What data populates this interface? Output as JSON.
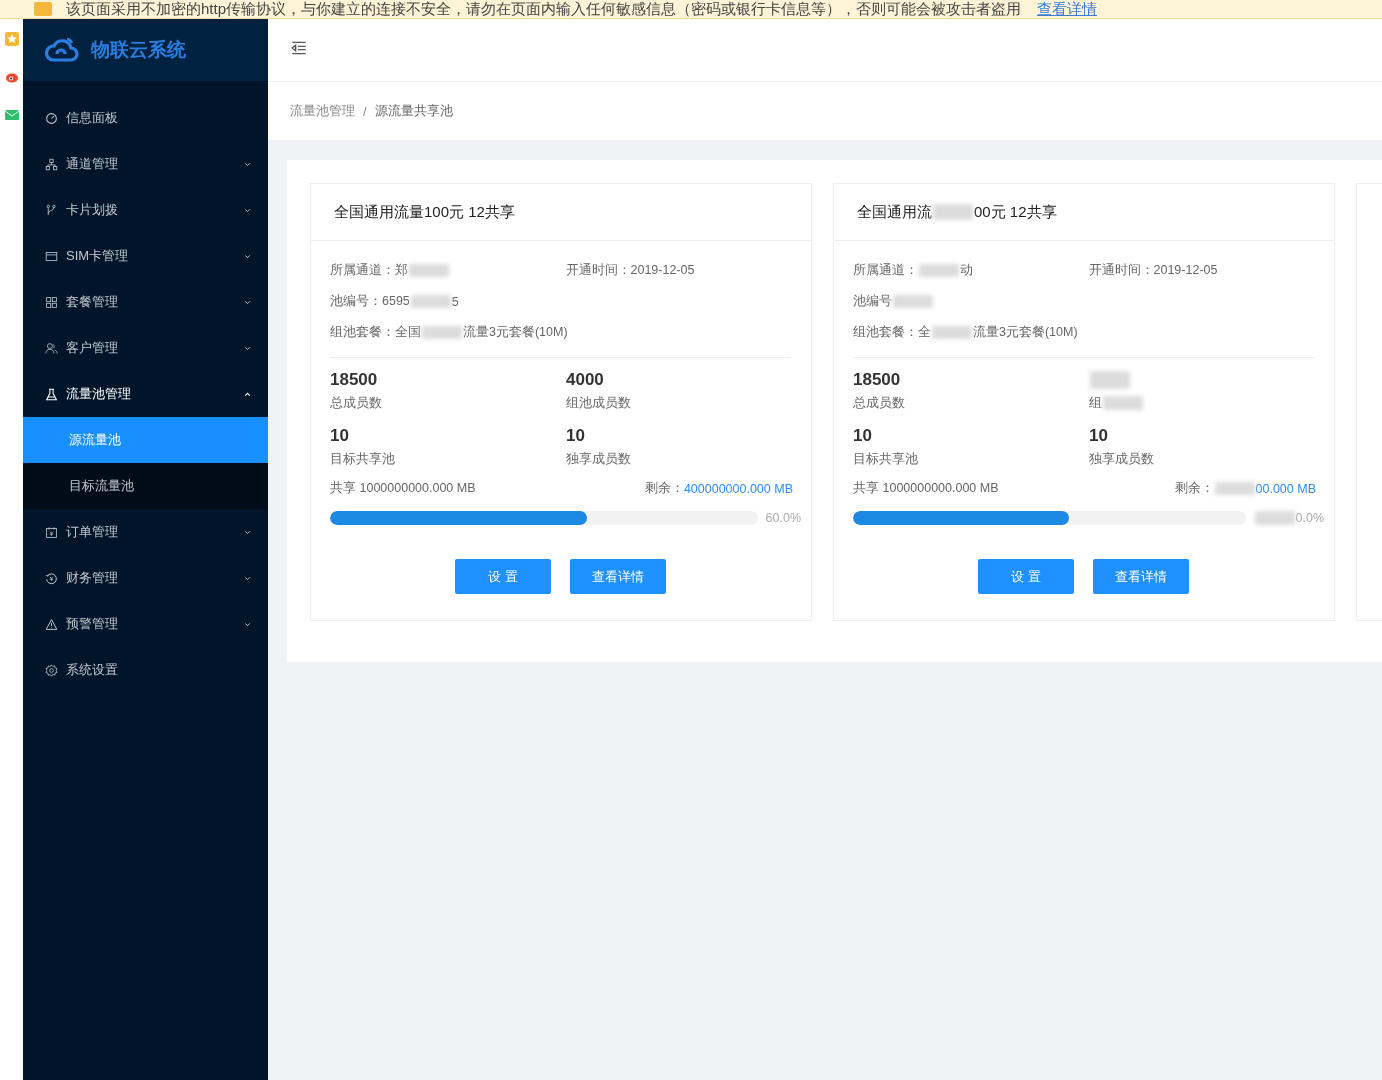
{
  "browser_warning": {
    "text": "该页面采用不加密的http传输协议，与你建立的连接不安全，请勿在页面内输入任何敏感信息（密码或银行卡信息等），否则可能会被攻击者盗用",
    "link": "查看详情"
  },
  "sidebar": {
    "logo": "物联云系统",
    "items": [
      {
        "label": "信息面板",
        "kind": "link",
        "selected": false
      },
      {
        "label": "通道管理",
        "kind": "submenu",
        "expanded": false,
        "selected": false
      },
      {
        "label": "卡片划拨",
        "kind": "submenu",
        "expanded": false,
        "selected": false
      },
      {
        "label": "SIM卡管理",
        "kind": "submenu",
        "expanded": false,
        "selected": false
      },
      {
        "label": "套餐管理",
        "kind": "submenu",
        "expanded": false,
        "selected": false
      },
      {
        "label": "客户管理",
        "kind": "submenu",
        "expanded": false,
        "selected": false
      },
      {
        "label": "流量池管理",
        "kind": "submenu",
        "expanded": true,
        "selected": false,
        "children": [
          {
            "label": "源流量池",
            "selected": true
          },
          {
            "label": "目标流量池",
            "selected": false
          }
        ]
      },
      {
        "label": "订单管理",
        "kind": "submenu",
        "expanded": false,
        "selected": false
      },
      {
        "label": "财务管理",
        "kind": "submenu",
        "expanded": false,
        "selected": false
      },
      {
        "label": "预警管理",
        "kind": "submenu",
        "expanded": false,
        "selected": false
      },
      {
        "label": "系统设置",
        "kind": "link",
        "selected": false
      }
    ]
  },
  "breadcrumb": [
    {
      "text": "流量池管理",
      "kind": "link"
    },
    {
      "text": "/",
      "kind": "separator"
    },
    {
      "text": "源流量共享池",
      "kind": "current"
    }
  ],
  "cards": [
    {
      "title": [
        {
          "text": "全国通用流量100元 12共享"
        }
      ],
      "channel": [
        {
          "text": "所属通道：郑"
        },
        {
          "kind": "blur"
        }
      ],
      "opened": [
        {
          "text": "开通时间：2019-12-05"
        }
      ],
      "pool_no": [
        {
          "text": "池编号：6595"
        },
        {
          "kind": "blur"
        },
        {
          "text": "5"
        }
      ],
      "plan": [
        {
          "text": "组池套餐：全国"
        },
        {
          "kind": "blur"
        },
        {
          "text": "流量3元套餐(10M)"
        }
      ],
      "stats": [
        {
          "value": [
            {
              "text": "18500"
            }
          ],
          "label": [
            {
              "text": "总成员数"
            }
          ]
        },
        {
          "value": [
            {
              "text": "4000"
            }
          ],
          "label": [
            {
              "text": "组池成员数"
            }
          ]
        },
        {
          "value": [
            {
              "text": "10"
            }
          ],
          "label": [
            {
              "text": "目标共享池"
            }
          ]
        },
        {
          "value": [
            {
              "text": "10"
            }
          ],
          "label": [
            {
              "text": "独享成员数"
            }
          ]
        }
      ],
      "shared": [
        {
          "text": "共享 1000000000.000 MB"
        }
      ],
      "remaining_label": "剩余：",
      "remaining": [
        {
          "text": "400000000.000 MB"
        }
      ],
      "level": 0.6,
      "percent": [
        {
          "text": "60.0%"
        }
      ],
      "buttons": [
        "设 置",
        "查看详情"
      ]
    },
    {
      "title": [
        {
          "text": "全国通用流"
        },
        {
          "kind": "blur"
        },
        {
          "text": "00元 12共享"
        }
      ],
      "channel": [
        {
          "text": "所属通道："
        },
        {
          "kind": "blur"
        },
        {
          "text": "动"
        }
      ],
      "opened": [
        {
          "text": "开通时间：2019-12-05"
        }
      ],
      "pool_no": [
        {
          "text": "池编号"
        },
        {
          "kind": "blur"
        }
      ],
      "plan": [
        {
          "text": "组池套餐：全"
        },
        {
          "kind": "blur"
        },
        {
          "text": "流量3元套餐(10M)"
        }
      ],
      "stats": [
        {
          "value": [
            {
              "text": "18500"
            }
          ],
          "label": [
            {
              "text": "总成员数"
            }
          ]
        },
        {
          "value": [
            {
              "kind": "blur"
            }
          ],
          "label": [
            {
              "text": "组"
            },
            {
              "kind": "blur"
            }
          ]
        },
        {
          "value": [
            {
              "text": "10"
            }
          ],
          "label": [
            {
              "text": "目标共享池"
            }
          ]
        },
        {
          "value": [
            {
              "text": "10"
            }
          ],
          "label": [
            {
              "text": "独享成员数"
            }
          ]
        }
      ],
      "shared": [
        {
          "text": "共享 1000000000.000 MB"
        }
      ],
      "remaining_label": "剩余：",
      "remaining": [
        {
          "kind": "blur"
        },
        {
          "text": "00.000 MB"
        }
      ],
      "level": 0.55,
      "percent": [
        {
          "kind": "blur"
        },
        {
          "text": "0.0%"
        }
      ],
      "buttons": [
        "设 置",
        "查看详情"
      ]
    }
  ]
}
